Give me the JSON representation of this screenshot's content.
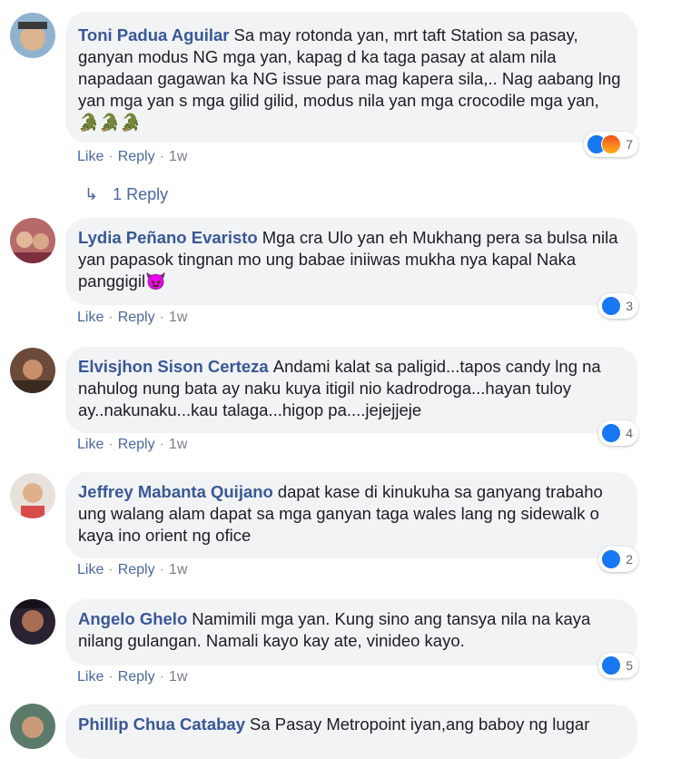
{
  "comments": [
    {
      "author": "Toni Padua Aguilar",
      "text": "Sa may rotonda yan, mrt taft Station sa pasay, ganyan modus NG mga yan, kapag d ka taga pasay at alam nila napadaan gagawan ka NG issue para mag kapera sila,.. Nag aabang lng yan mga yan s mga gilid gilid, modus nila yan mga crocodile mga yan, 🐊🐊🐊",
      "reaction_count": "7",
      "time": "1w"
    },
    {
      "author": "Lydia Peñano Evaristo",
      "text": "Mga cra Ulo yan eh Mukhang pera sa bulsa nila yan papasok tingnan mo ung babae iniiwas mukha nya kapal Naka panggigil😈",
      "reaction_count": "3",
      "time": "1w"
    },
    {
      "author": "Elvisjhon Sison Certeza",
      "text": "Andami kalat sa paligid...tapos candy lng na nahulog nung bata ay naku kuya itigil nio kadrodroga...hayan tuloy ay..nakunaku...kau talaga...higop pa....jejejjeje",
      "reaction_count": "4",
      "time": "1w"
    },
    {
      "author": "Jeffrey Mabanta Quijano",
      "text": "dapat kase di kinukuha sa ganyang trabaho ung walang alam dapat sa mga ganyan taga wales lang ng sidewalk o kaya ino orient ng ofice",
      "reaction_count": "2",
      "time": "1w"
    },
    {
      "author": "Angelo Ghelo",
      "text": "Namimili mga yan. Kung sino ang tansya nila na kaya nilang gulangan. Namali kayo kay ate, vinideo kayo.",
      "reaction_count": "5",
      "time": "1w"
    },
    {
      "author": "Phillip Chua Catabay",
      "text": "Sa Pasay Metropoint iyan,ang baboy ng lugar"
    }
  ],
  "labels": {
    "like": "Like",
    "reply": "Reply",
    "separator": "·"
  },
  "replies_link": "1 Reply",
  "colors": {
    "author": "#385898",
    "bubble": "#f2f3f5",
    "like_blue": "#1877f2",
    "link": "#4b67a1"
  }
}
